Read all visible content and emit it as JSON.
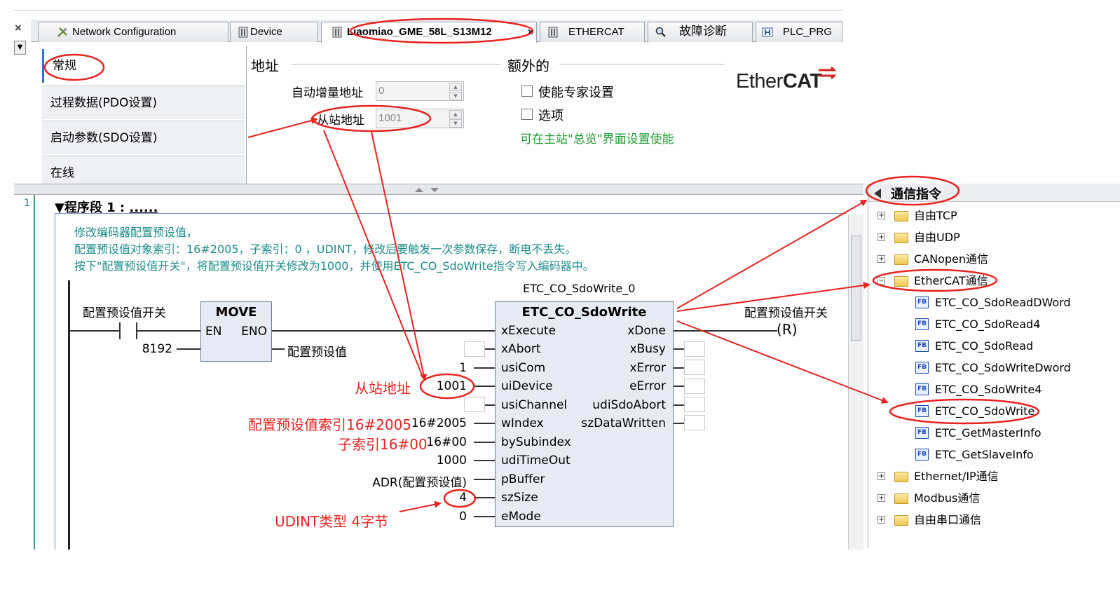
{
  "tabs": [
    {
      "label": "Network Configuration",
      "icon": "network-config-icon"
    },
    {
      "label": "Device",
      "icon": "device-icon"
    },
    {
      "label": "Liaomiao_GME_58L_S13M12",
      "icon": "device-icon",
      "active": true
    },
    {
      "label": "ETHERCAT",
      "icon": "device-icon"
    },
    {
      "label": "故障诊断",
      "icon": "magnifier-icon"
    },
    {
      "label": "PLC_PRG",
      "icon": "program-icon"
    }
  ],
  "nav": {
    "items": [
      {
        "label": "常规"
      },
      {
        "label": "过程数据(PDO设置)"
      },
      {
        "label": "启动参数(SDO设置)"
      },
      {
        "label": "在线"
      }
    ]
  },
  "address_section": {
    "title": "地址",
    "auto_inc_label": "自动增量地址",
    "auto_inc_value": "0",
    "slave_addr_label": "从站地址",
    "slave_addr_value": "1001"
  },
  "extra_section": {
    "title": "额外的",
    "expert_label": "使能专家设置",
    "options_label": "选项",
    "note": "可在主站\"总览\"界面设置使能"
  },
  "brand": {
    "prefix": "Ether",
    "suffix": "CAT"
  },
  "ladder": {
    "line_number": "1",
    "network_title": "程序段 1 :",
    "network_dots": "......",
    "comments": [
      "修改编码器配置预设值，",
      "配置预设值对象索引：16#2005，子索引：0 ，UDINT，修改后要触发一次参数保存，断电不丢失。",
      "按下\"配置预设值开关\"，将配置预设值开关修改为1000，并使用ETC_CO_SdoWrite指令写入编码器中。"
    ],
    "contact_label": "配置预设值开关",
    "move": {
      "title": "MOVE",
      "en": "EN",
      "eno": "ENO",
      "input": "8192",
      "output": "配置预设值"
    },
    "fb_instance": "ETC_CO_SdoWrite_0",
    "fb": {
      "title": "ETC_CO_SdoWrite",
      "inputs": [
        "xExecute",
        "xAbort",
        "usiCom",
        "uiDevice",
        "usiChannel",
        "wIndex",
        "bySubindex",
        "udiTimeOut",
        "pBuffer",
        "szSize",
        "eMode"
      ],
      "outputs": [
        "xDone",
        "xBusy",
        "xError",
        "eError",
        "udiSdoAbort",
        "szDataWritten"
      ],
      "input_values": [
        "",
        "",
        "1",
        "1001",
        "",
        "16#2005",
        "16#00",
        "1000",
        "ADR(配置预设值)",
        "4",
        "0"
      ]
    },
    "coil_label": "配置预设值开关",
    "coil": "R"
  },
  "annotations": {
    "slave_addr": "从站地址",
    "index": "配置预设值索引16#2005",
    "subindex": "子索引16#00",
    "size": "UDINT类型 4字节"
  },
  "tree": {
    "title": "通信指令",
    "items": [
      {
        "label": "自由TCP",
        "type": "folder"
      },
      {
        "label": "自由UDP",
        "type": "folder"
      },
      {
        "label": "CANopen通信",
        "type": "folder"
      },
      {
        "label": "EtherCAT通信",
        "type": "folder-open"
      },
      {
        "label": "ETC_CO_SdoReadDWord",
        "type": "fb"
      },
      {
        "label": "ETC_CO_SdoRead4",
        "type": "fb"
      },
      {
        "label": "ETC_CO_SdoRead",
        "type": "fb"
      },
      {
        "label": "ETC_CO_SdoWriteDword",
        "type": "fb"
      },
      {
        "label": "ETC_CO_SdoWrite4",
        "type": "fb"
      },
      {
        "label": "ETC_CO_SdoWrite",
        "type": "fb"
      },
      {
        "label": "ETC_GetMasterInfo",
        "type": "fb"
      },
      {
        "label": "ETC_GetSlaveInfo",
        "type": "fb"
      },
      {
        "label": "Ethernet/IP通信",
        "type": "folder"
      },
      {
        "label": "Modbus通信",
        "type": "folder"
      },
      {
        "label": "自由串口通信",
        "type": "folder"
      }
    ]
  },
  "colors": {
    "annotation": "#e8231f",
    "comment": "#1a8b8b",
    "note_green": "#1b9b2f",
    "fb_fill": "#e6ecf3"
  }
}
